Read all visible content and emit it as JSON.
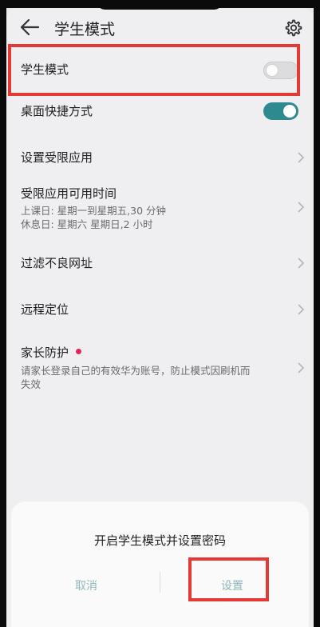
{
  "header": {
    "title": "学生模式",
    "back_icon": "arrow-left-icon",
    "settings_icon": "gear-icon"
  },
  "rows": {
    "student_mode": {
      "label": "学生模式",
      "toggle_on": false
    },
    "desktop_shortcut": {
      "label": "桌面快捷方式",
      "toggle_on": true
    },
    "restricted_apps": {
      "label": "设置受限应用"
    },
    "available_time": {
      "label": "受限应用可用时间",
      "line1": "上课日: 星期一到星期五,30 分钟",
      "line2": "休息日: 星期六 星期日,2 小时"
    },
    "filter_urls": {
      "label": "过滤不良网址"
    },
    "remote_location": {
      "label": "远程定位"
    },
    "parental_protection": {
      "label": "家长防护",
      "desc_line1": "请家长登录自己的有效华为账号，防止模式因刷机而",
      "desc_line2": "失效"
    }
  },
  "dialog": {
    "message": "开启学生模式并设置密码",
    "cancel_label": "取消",
    "set_label": "设置"
  },
  "colors": {
    "accent": "#2f8a8f",
    "highlight": "#e53935",
    "dot": "#e0245e",
    "dialog_button_text": "#8fb6bb"
  }
}
